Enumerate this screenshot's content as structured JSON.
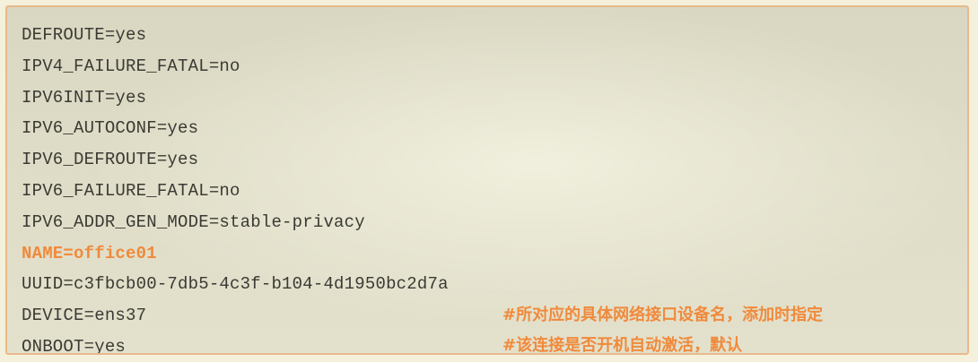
{
  "config_lines": [
    "DEFROUTE=yes",
    "IPV4_FAILURE_FATAL=no",
    "IPV6INIT=yes",
    "IPV6_AUTOCONF=yes",
    "IPV6_DEFROUTE=yes",
    "IPV6_FAILURE_FATAL=no",
    "IPV6_ADDR_GEN_MODE=stable-privacy",
    "NAME=office01",
    "UUID=c3fbcb00-7db5-4c3f-b104-4d1950bc2d7a",
    "DEVICE=ens37",
    "ONBOOT=yes"
  ],
  "comments": {
    "device": "#所对应的具体网络接口设备名，添加时指定",
    "onboot": "#该连接是否开机自动激活，默认"
  },
  "colors": {
    "highlight": "#f08a3c",
    "text": "#3a3a34",
    "border": "#e8b98c"
  }
}
